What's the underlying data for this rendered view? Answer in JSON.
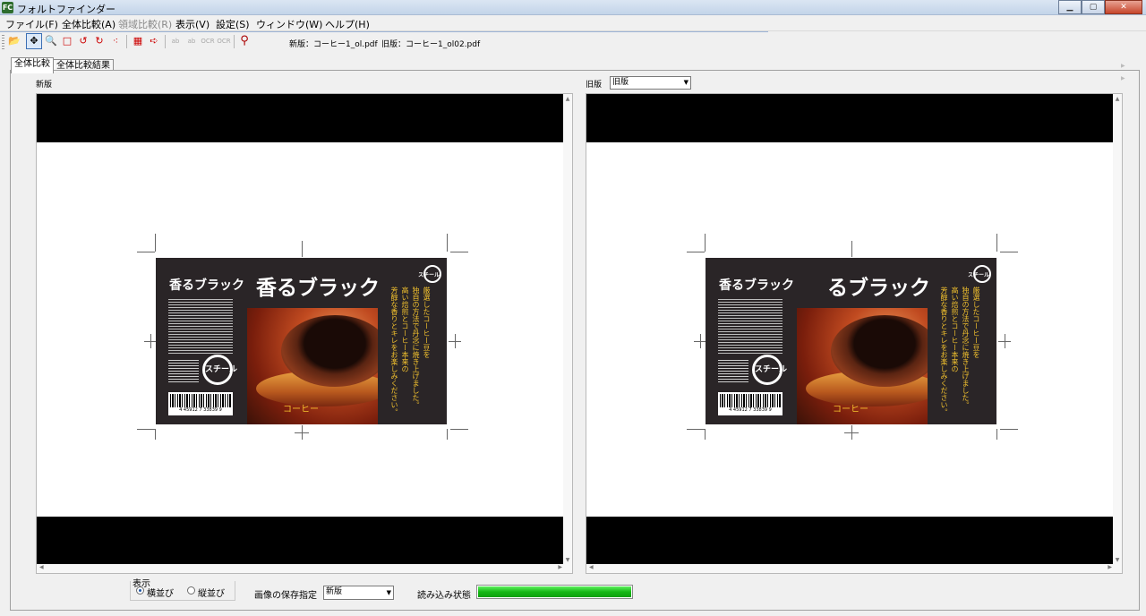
{
  "window": {
    "title": "フォルトファインダー",
    "icon_text": "FC",
    "buttons": [
      "minimize",
      "maximize",
      "close"
    ]
  },
  "menu": {
    "items": [
      {
        "label": "ファイル(F)",
        "enabled": true
      },
      {
        "label": "全体比較(A)",
        "enabled": true
      },
      {
        "label": "領域比較(R)",
        "enabled": false
      },
      {
        "label": "表示(V)",
        "enabled": true
      },
      {
        "label": "設定(S)",
        "enabled": true
      },
      {
        "label": "ウィンドウ(W)",
        "enabled": true
      },
      {
        "label": "ヘルプ(H)",
        "enabled": true
      }
    ]
  },
  "toolbar": {
    "tools": [
      {
        "icon": "open-folder-icon",
        "glyph": "📂"
      },
      {
        "icon": "pan-icon",
        "glyph": "✥",
        "active": true
      },
      {
        "icon": "zoom-icon",
        "glyph": "🔍"
      },
      {
        "icon": "rectangle-select-icon",
        "glyph": "□"
      },
      {
        "icon": "rotate-left-icon",
        "glyph": "↺"
      },
      {
        "icon": "rotate-right-icon",
        "glyph": "↻"
      },
      {
        "icon": "scatter-icon",
        "glyph": "⁖"
      },
      {
        "icon": "compare-icon",
        "glyph": "▦"
      },
      {
        "icon": "export-icon",
        "glyph": "➪"
      },
      {
        "icon": "ocr-1-icon",
        "glyph": "ab",
        "disabled": true
      },
      {
        "icon": "ocr-2-icon",
        "glyph": "ab",
        "disabled": true
      },
      {
        "icon": "ocr-3-icon",
        "glyph": "OCR",
        "disabled": true
      },
      {
        "icon": "ocr-4-icon",
        "glyph": "OCR",
        "disabled": true
      },
      {
        "icon": "inspect-icon",
        "glyph": "⚲"
      }
    ],
    "new_file": "新版：コーヒー1_ol.pdf",
    "old_file": "旧版：コーヒー1_ol02.pdf"
  },
  "tabs": [
    {
      "label": "全体比較",
      "active": true
    },
    {
      "label": "全体比較結果",
      "active": false
    }
  ],
  "left_panel": {
    "label": "新版",
    "artwork": {
      "brand_small": "香るブラック",
      "brand_big": "香るブラック",
      "recycle_label": "スチール",
      "photo_caption": "コーヒー",
      "barcode_number": "4 45912 7 33839 9",
      "vertical_lines": [
        "厳選したコーヒー豆を",
        "独自の方法で丹念に焼き上げました。",
        "高い焙煎とコーヒー本来の",
        "芳醇な香りとキレをお楽しみください。"
      ]
    }
  },
  "right_panel": {
    "label": "旧版",
    "select_value": "旧版",
    "artwork": {
      "brand_small": "香るブラック",
      "brand_big": "るブラック",
      "recycle_label": "スチール",
      "photo_caption": "コーヒー",
      "barcode_number": "4 45912 7 33839 9",
      "vertical_lines": [
        "厳選したコーヒー豆を",
        "独自の方法で丹念に焼き上げました。",
        "高い焙煎とコーヒー本来の",
        "芳醇な香りとキレをお楽しみください。"
      ]
    }
  },
  "bottom": {
    "display_group_title": "表示",
    "radio_options": [
      {
        "label": "横並び",
        "checked": true
      },
      {
        "label": "縦並び",
        "checked": false
      }
    ],
    "save_label": "画像の保存指定",
    "save_select_value": "新版",
    "load_status_label": "読み込み状態",
    "load_progress": 1.0
  },
  "colors": {
    "label_background": "#2a2527",
    "accent_gold": "#f2c12e",
    "progress_green": "#16b816"
  }
}
